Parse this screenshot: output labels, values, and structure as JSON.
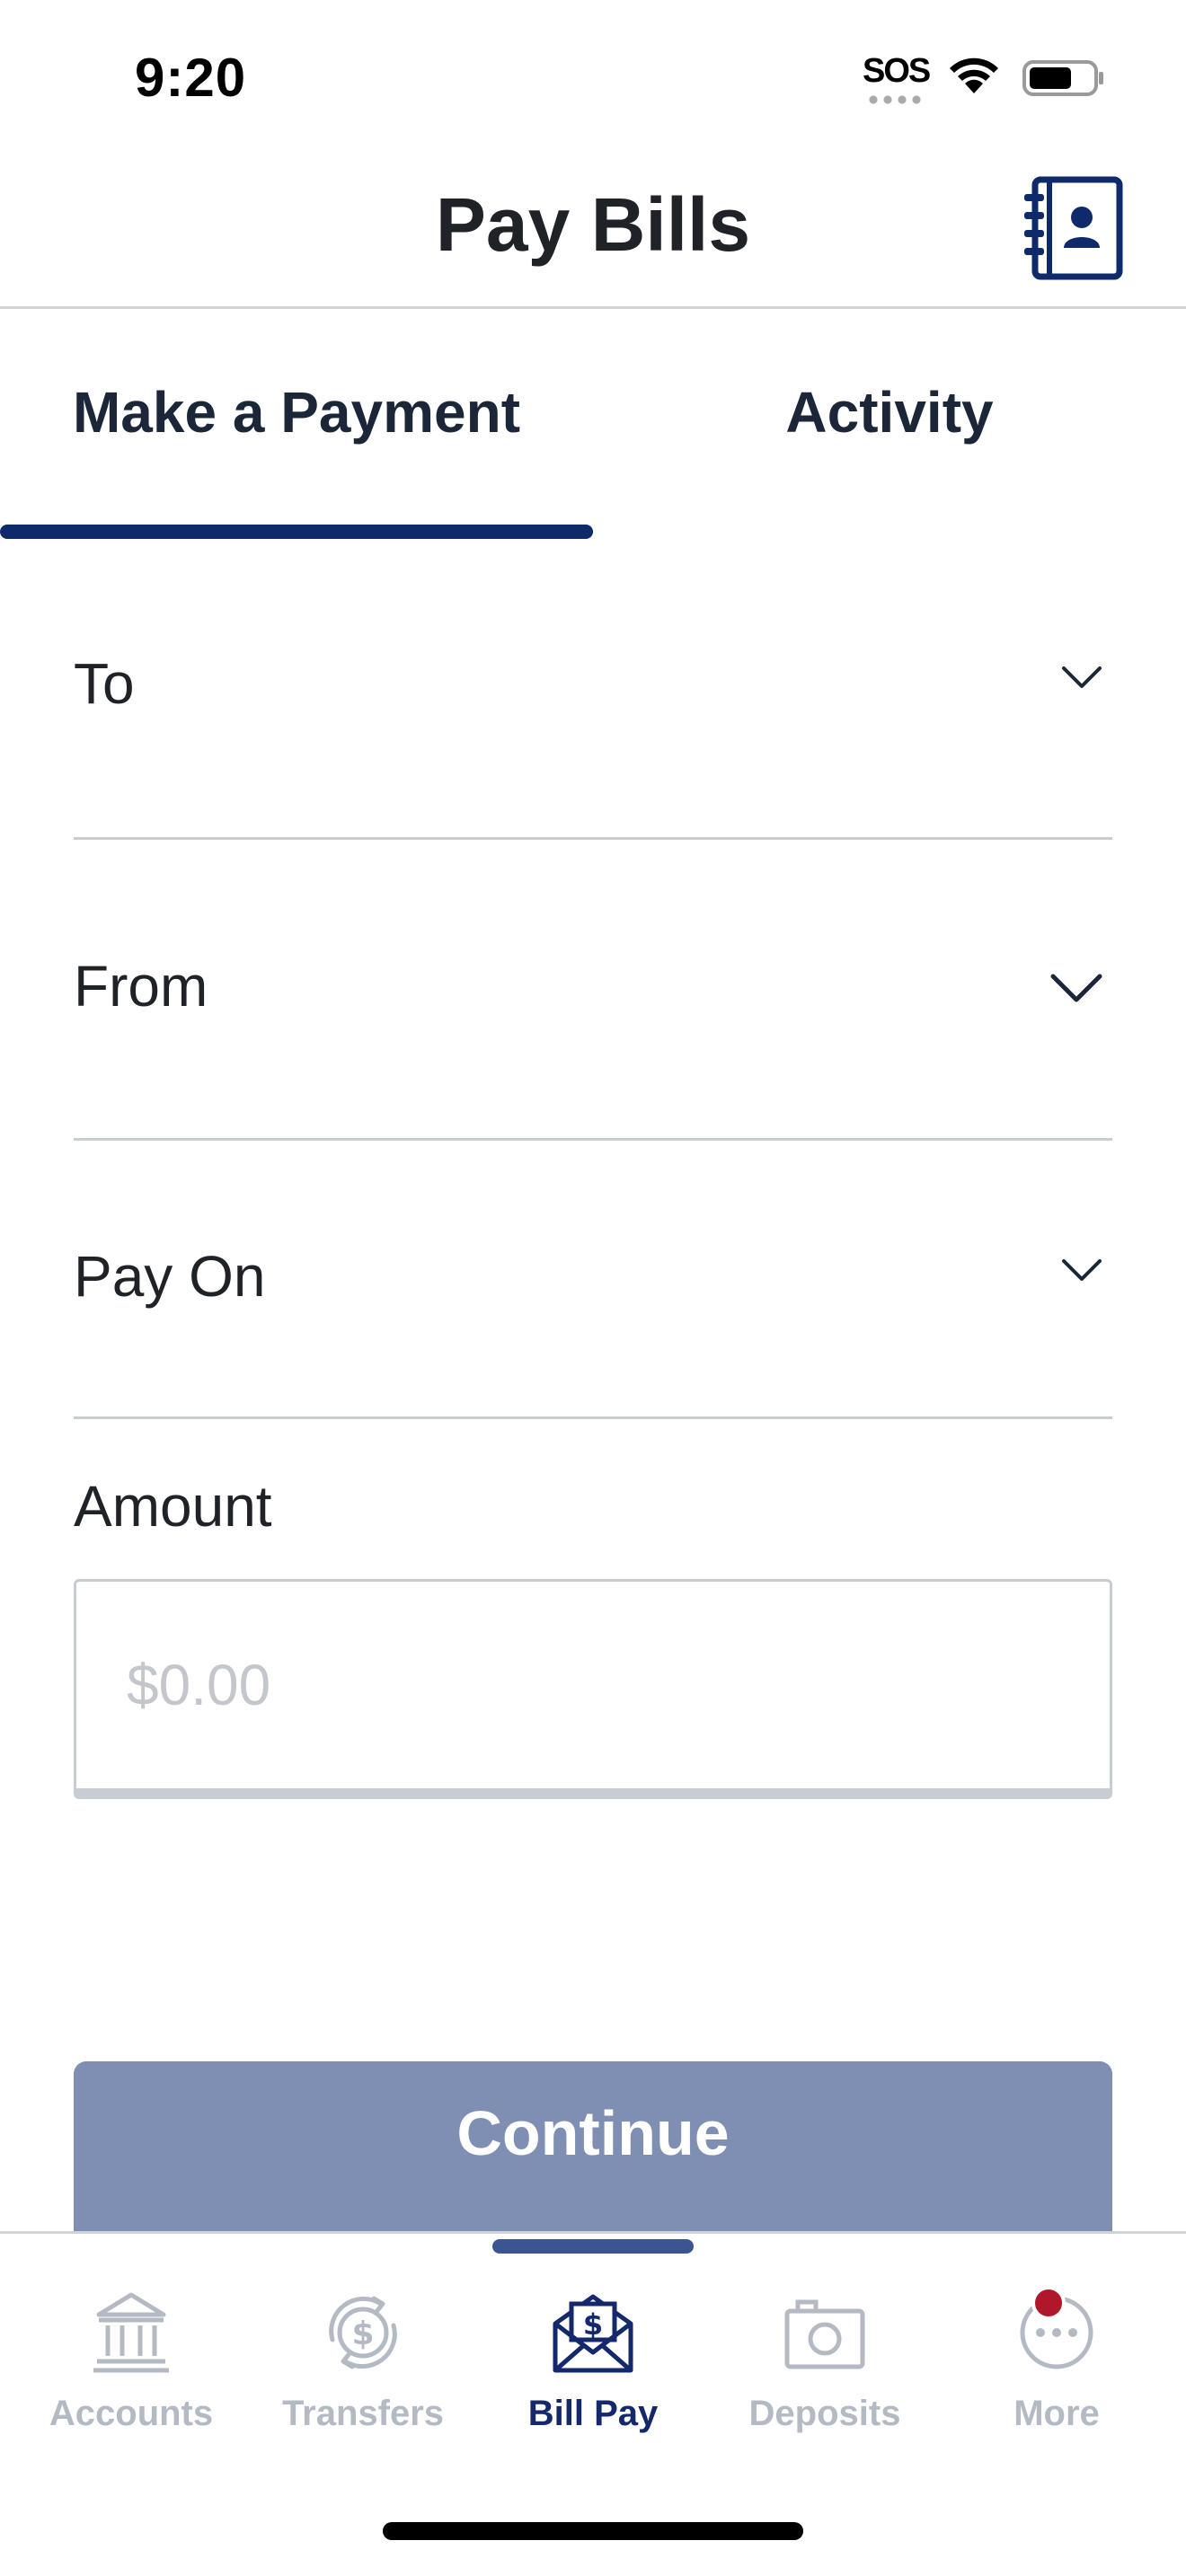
{
  "status_bar": {
    "time": "9:20",
    "sos": "SOS"
  },
  "header": {
    "title": "Pay Bills",
    "contacts_icon": "address-book-icon"
  },
  "tabs": [
    {
      "label": "Make a Payment",
      "active": true
    },
    {
      "label": "Activity",
      "active": false
    }
  ],
  "form": {
    "to_label": "To",
    "from_label": "From",
    "pay_on_label": "Pay On",
    "amount_label": "Amount",
    "amount_placeholder": "$0.00",
    "amount_value": ""
  },
  "continue_label": "Continue",
  "tab_bar": {
    "items": [
      {
        "label": "Accounts",
        "icon": "bank-icon",
        "active": false
      },
      {
        "label": "Transfers",
        "icon": "transfer-dollar-icon",
        "active": false
      },
      {
        "label": "Bill Pay",
        "icon": "envelope-dollar-icon",
        "active": true
      },
      {
        "label": "Deposits",
        "icon": "camera-icon",
        "active": false
      },
      {
        "label": "More",
        "icon": "more-icon",
        "active": false
      }
    ]
  },
  "colors": {
    "primary": "#0f2a6b",
    "button_disabled": "#7f8fb3",
    "inactive_tab": "#b4bac4",
    "notification": "#b1172a",
    "divider": "#c8ccd3"
  }
}
